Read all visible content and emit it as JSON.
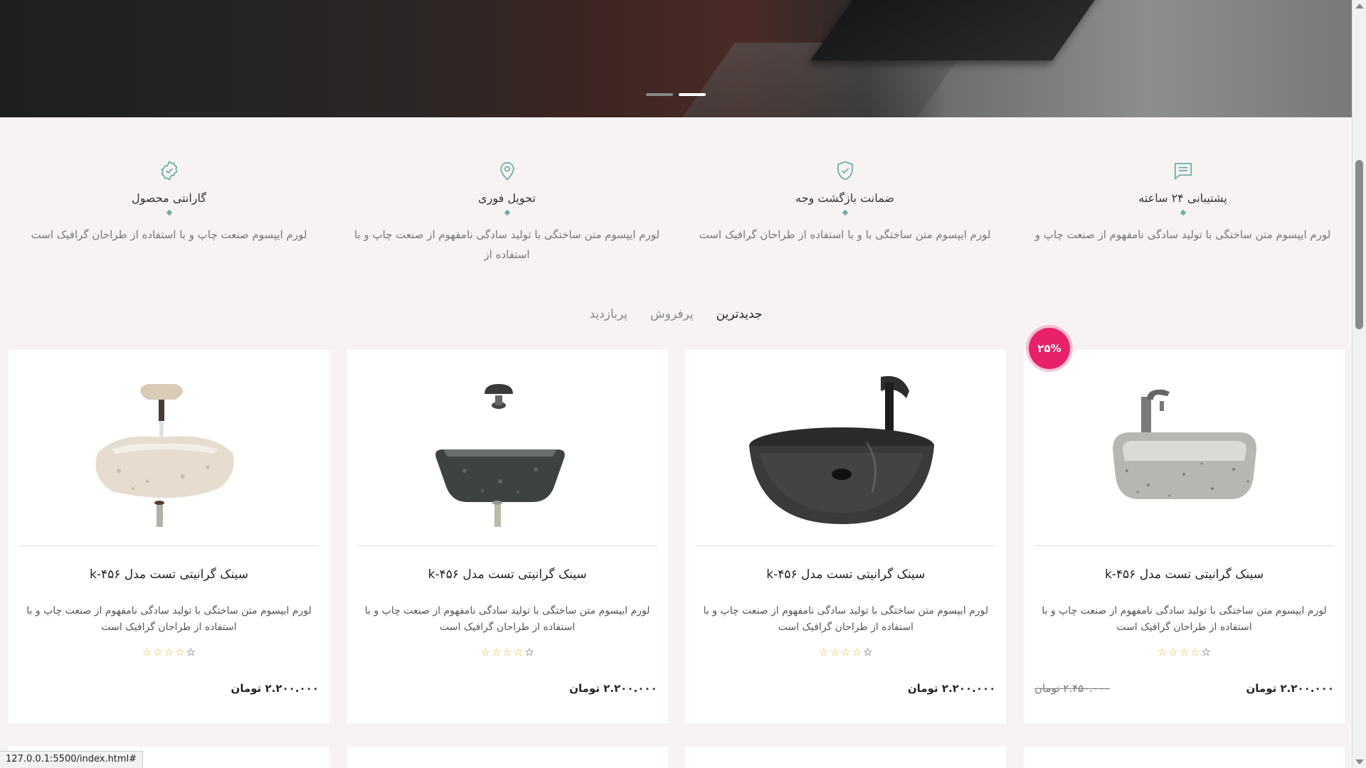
{
  "hero": {
    "slides": 2,
    "active_slide": 2
  },
  "features": [
    {
      "icon": "chat-icon",
      "title": "پشتیبانی ۲۴ ساعته",
      "desc": "لورم ایپسوم متن ساختگی با تولید سادگی نامفهوم از صنعت چاپ و"
    },
    {
      "icon": "shield-check-icon",
      "title": "ضمانت بازگشت وجه",
      "desc": "لورم ایپسوم متن ساختگی با و با استفاده از طراحان گرافیک است"
    },
    {
      "icon": "map-pin-icon",
      "title": "تحویل فوری",
      "desc": "لورم ایپسوم متن ساختگی با تولید سادگی نامفهوم از صنعت چاپ و با استفاده از"
    },
    {
      "icon": "badge-check-icon",
      "title": "گارانتی محصول",
      "desc": "لورم ایپسوم صنعت چاپ و با استفاده از طراحان گرافیک است"
    }
  ],
  "tabs": [
    {
      "label": "جدیدترین",
      "active": true
    },
    {
      "label": "پرفروش",
      "active": false
    },
    {
      "label": "پربازدید",
      "active": false
    }
  ],
  "products": [
    {
      "title": "سینک گرانیتی تست مدل k-۴۵۶",
      "desc": "لورم ایپسوم متن ساختگی با تولید سادگی نامفهوم از صنعت چاپ و با استفاده از طراحان گرافیک است",
      "price": "۲.۲۰۰.۰۰۰ تومان",
      "old_price": "۲.۴۵۰.۰۰۰ تومان",
      "badge": "۲۵%",
      "rating": 0
    },
    {
      "title": "سینک گرانیتی تست مدل k-۴۵۶",
      "desc": "لورم ایپسوم متن ساختگی با تولید سادگی نامفهوم از صنعت چاپ و با استفاده از طراحان گرافیک است",
      "price": "۲.۲۰۰.۰۰۰ تومان",
      "rating": 0
    },
    {
      "title": "سینک گرانیتی تست مدل k-۴۵۶",
      "desc": "لورم ایپسوم متن ساختگی با تولید سادگی نامفهوم از صنعت چاپ و با استفاده از طراحان گرافیک است",
      "price": "۲.۲۰۰.۰۰۰ تومان",
      "rating": 0
    },
    {
      "title": "سینک گرانیتی تست مدل k-۴۵۶",
      "desc": "لورم ایپسوم متن ساختگی با تولید سادگی نامفهوم از صنعت چاپ و با استفاده از طراحان گرافیک است",
      "price": "۲.۲۰۰.۰۰۰ تومان",
      "rating": 0
    }
  ],
  "status_url": "127.0.0.1:5500/index.html#",
  "colors": {
    "accent": "#6aaea1",
    "badge": "#e8216b",
    "star": "#e7b733",
    "background": "#f8f3f3"
  }
}
